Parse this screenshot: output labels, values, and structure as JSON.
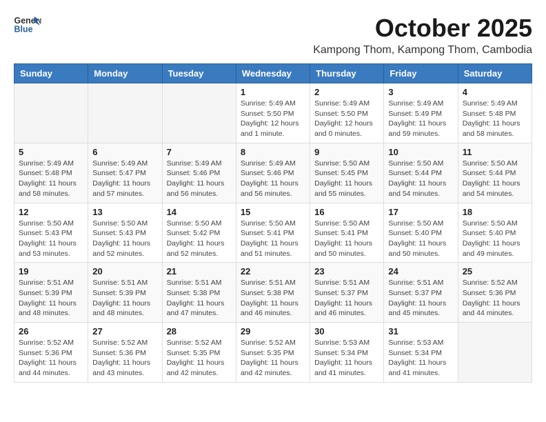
{
  "header": {
    "logo_general": "General",
    "logo_blue": "Blue",
    "month_year": "October 2025",
    "subtitle": "Kampong Thom, Kampong Thom, Cambodia"
  },
  "weekdays": [
    "Sunday",
    "Monday",
    "Tuesday",
    "Wednesday",
    "Thursday",
    "Friday",
    "Saturday"
  ],
  "weeks": [
    [
      {
        "day": "",
        "info": ""
      },
      {
        "day": "",
        "info": ""
      },
      {
        "day": "",
        "info": ""
      },
      {
        "day": "1",
        "info": "Sunrise: 5:49 AM\nSunset: 5:50 PM\nDaylight: 12 hours\nand 1 minute."
      },
      {
        "day": "2",
        "info": "Sunrise: 5:49 AM\nSunset: 5:50 PM\nDaylight: 12 hours\nand 0 minutes."
      },
      {
        "day": "3",
        "info": "Sunrise: 5:49 AM\nSunset: 5:49 PM\nDaylight: 11 hours\nand 59 minutes."
      },
      {
        "day": "4",
        "info": "Sunrise: 5:49 AM\nSunset: 5:48 PM\nDaylight: 11 hours\nand 58 minutes."
      }
    ],
    [
      {
        "day": "5",
        "info": "Sunrise: 5:49 AM\nSunset: 5:48 PM\nDaylight: 11 hours\nand 58 minutes."
      },
      {
        "day": "6",
        "info": "Sunrise: 5:49 AM\nSunset: 5:47 PM\nDaylight: 11 hours\nand 57 minutes."
      },
      {
        "day": "7",
        "info": "Sunrise: 5:49 AM\nSunset: 5:46 PM\nDaylight: 11 hours\nand 56 minutes."
      },
      {
        "day": "8",
        "info": "Sunrise: 5:49 AM\nSunset: 5:46 PM\nDaylight: 11 hours\nand 56 minutes."
      },
      {
        "day": "9",
        "info": "Sunrise: 5:50 AM\nSunset: 5:45 PM\nDaylight: 11 hours\nand 55 minutes."
      },
      {
        "day": "10",
        "info": "Sunrise: 5:50 AM\nSunset: 5:44 PM\nDaylight: 11 hours\nand 54 minutes."
      },
      {
        "day": "11",
        "info": "Sunrise: 5:50 AM\nSunset: 5:44 PM\nDaylight: 11 hours\nand 54 minutes."
      }
    ],
    [
      {
        "day": "12",
        "info": "Sunrise: 5:50 AM\nSunset: 5:43 PM\nDaylight: 11 hours\nand 53 minutes."
      },
      {
        "day": "13",
        "info": "Sunrise: 5:50 AM\nSunset: 5:43 PM\nDaylight: 11 hours\nand 52 minutes."
      },
      {
        "day": "14",
        "info": "Sunrise: 5:50 AM\nSunset: 5:42 PM\nDaylight: 11 hours\nand 52 minutes."
      },
      {
        "day": "15",
        "info": "Sunrise: 5:50 AM\nSunset: 5:41 PM\nDaylight: 11 hours\nand 51 minutes."
      },
      {
        "day": "16",
        "info": "Sunrise: 5:50 AM\nSunset: 5:41 PM\nDaylight: 11 hours\nand 50 minutes."
      },
      {
        "day": "17",
        "info": "Sunrise: 5:50 AM\nSunset: 5:40 PM\nDaylight: 11 hours\nand 50 minutes."
      },
      {
        "day": "18",
        "info": "Sunrise: 5:50 AM\nSunset: 5:40 PM\nDaylight: 11 hours\nand 49 minutes."
      }
    ],
    [
      {
        "day": "19",
        "info": "Sunrise: 5:51 AM\nSunset: 5:39 PM\nDaylight: 11 hours\nand 48 minutes."
      },
      {
        "day": "20",
        "info": "Sunrise: 5:51 AM\nSunset: 5:39 PM\nDaylight: 11 hours\nand 48 minutes."
      },
      {
        "day": "21",
        "info": "Sunrise: 5:51 AM\nSunset: 5:38 PM\nDaylight: 11 hours\nand 47 minutes."
      },
      {
        "day": "22",
        "info": "Sunrise: 5:51 AM\nSunset: 5:38 PM\nDaylight: 11 hours\nand 46 minutes."
      },
      {
        "day": "23",
        "info": "Sunrise: 5:51 AM\nSunset: 5:37 PM\nDaylight: 11 hours\nand 46 minutes."
      },
      {
        "day": "24",
        "info": "Sunrise: 5:51 AM\nSunset: 5:37 PM\nDaylight: 11 hours\nand 45 minutes."
      },
      {
        "day": "25",
        "info": "Sunrise: 5:52 AM\nSunset: 5:36 PM\nDaylight: 11 hours\nand 44 minutes."
      }
    ],
    [
      {
        "day": "26",
        "info": "Sunrise: 5:52 AM\nSunset: 5:36 PM\nDaylight: 11 hours\nand 44 minutes."
      },
      {
        "day": "27",
        "info": "Sunrise: 5:52 AM\nSunset: 5:36 PM\nDaylight: 11 hours\nand 43 minutes."
      },
      {
        "day": "28",
        "info": "Sunrise: 5:52 AM\nSunset: 5:35 PM\nDaylight: 11 hours\nand 42 minutes."
      },
      {
        "day": "29",
        "info": "Sunrise: 5:52 AM\nSunset: 5:35 PM\nDaylight: 11 hours\nand 42 minutes."
      },
      {
        "day": "30",
        "info": "Sunrise: 5:53 AM\nSunset: 5:34 PM\nDaylight: 11 hours\nand 41 minutes."
      },
      {
        "day": "31",
        "info": "Sunrise: 5:53 AM\nSunset: 5:34 PM\nDaylight: 11 hours\nand 41 minutes."
      },
      {
        "day": "",
        "info": ""
      }
    ]
  ]
}
